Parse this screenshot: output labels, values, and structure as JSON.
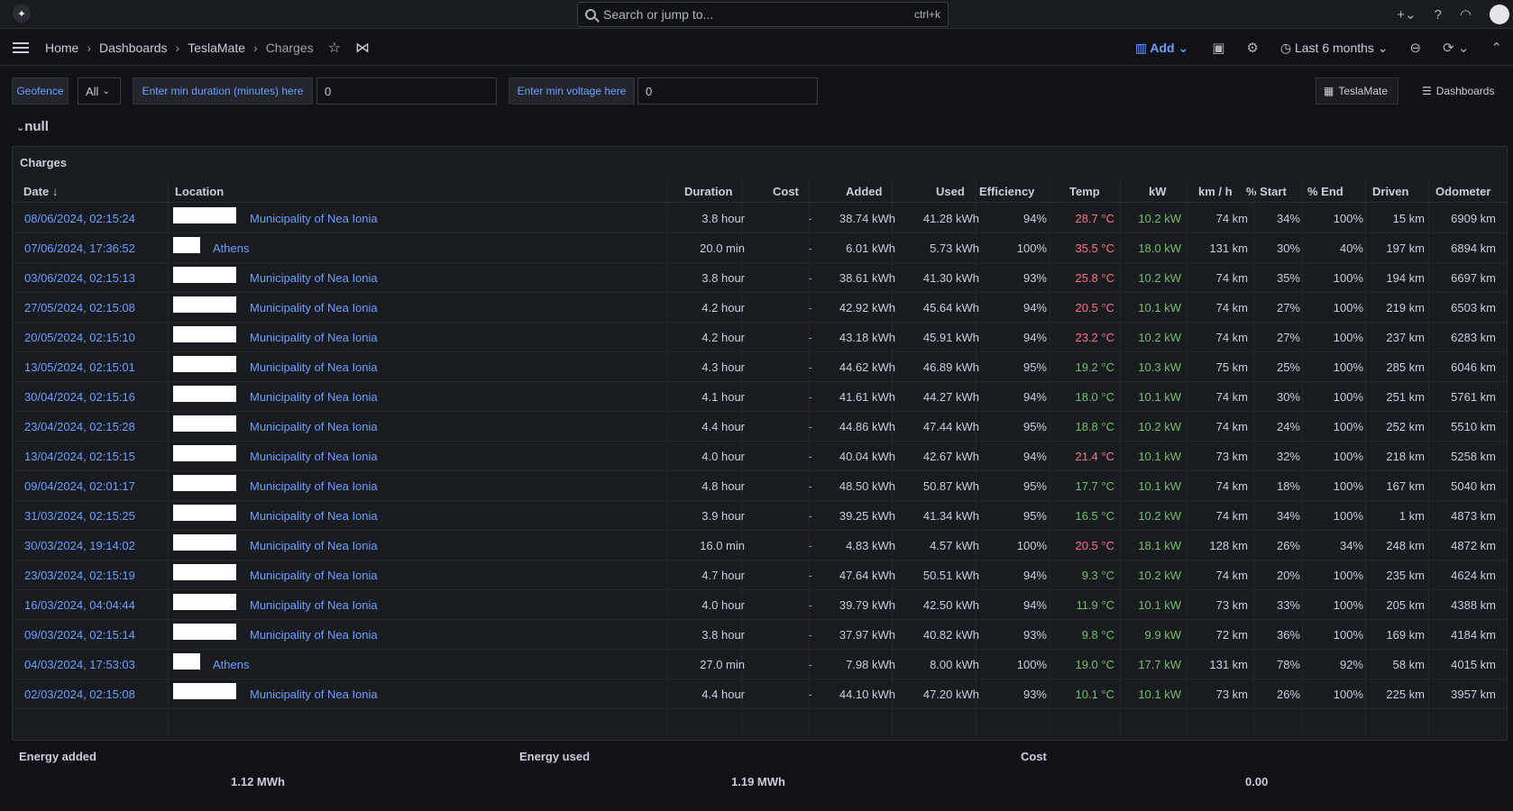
{
  "topbar": {
    "search_placeholder": "Search or jump to...",
    "search_shortcut": "ctrl+k"
  },
  "breadcrumb": [
    "Home",
    "Dashboards",
    "TeslaMate",
    "Charges"
  ],
  "navbar": {
    "add_label": "Add",
    "time_range": "Last 6 months"
  },
  "variables": {
    "geofence_label": "Geofence",
    "geofence_value": "All",
    "min_duration_label": "Enter min duration (minutes) here",
    "min_duration_value": "0",
    "min_voltage_label": "Enter min voltage here",
    "min_voltage_value": "0",
    "link_teslamate": "TeslaMate",
    "link_dashboards": "Dashboards"
  },
  "row_title": "null",
  "panel": {
    "title": "Charges",
    "columns": [
      "Date",
      "Location",
      "Duration",
      "Cost",
      "Added",
      "Used",
      "Efficiency",
      "Temp",
      "kW",
      "km / h",
      "% Start",
      "% End",
      "Driven",
      "Odometer"
    ],
    "rows": [
      {
        "date": "08/06/2024, 02:15:24",
        "location": "Municipality of Nea Ionia",
        "duration": "3.8 hour",
        "cost": "-",
        "added": "38.74 kWh",
        "used": "41.28 kWh",
        "efficiency": "94%",
        "temp": "28.7 °C",
        "temp_color": "#ff7383",
        "kw": "10.2 kW",
        "kmh": "74 km",
        "start": "34%",
        "end": "100%",
        "driven": "15 km",
        "odometer": "6909 km"
      },
      {
        "date": "07/06/2024, 17:36:52",
        "location": "Athens",
        "duration": "20.0 min",
        "cost": "-",
        "added": "6.01 kWh",
        "used": "5.73 kWh",
        "efficiency": "100%",
        "temp": "35.5 °C",
        "temp_color": "#ff7383",
        "kw": "18.0 kW",
        "kmh": "131 km",
        "start": "30%",
        "end": "40%",
        "driven": "197 km",
        "odometer": "6894 km"
      },
      {
        "date": "03/06/2024, 02:15:13",
        "location": "Municipality of Nea Ionia",
        "duration": "3.8 hour",
        "cost": "-",
        "added": "38.61 kWh",
        "used": "41.30 kWh",
        "efficiency": "93%",
        "temp": "25.8 °C",
        "temp_color": "#ff7383",
        "kw": "10.2 kW",
        "kmh": "74 km",
        "start": "35%",
        "end": "100%",
        "driven": "194 km",
        "odometer": "6697 km"
      },
      {
        "date": "27/05/2024, 02:15:08",
        "location": "Municipality of Nea Ionia",
        "duration": "4.2 hour",
        "cost": "-",
        "added": "42.92 kWh",
        "used": "45.64 kWh",
        "efficiency": "94%",
        "temp": "20.5 °C",
        "temp_color": "#ff7383",
        "kw": "10.1 kW",
        "kmh": "74 km",
        "start": "27%",
        "end": "100%",
        "driven": "219 km",
        "odometer": "6503 km"
      },
      {
        "date": "20/05/2024, 02:15:10",
        "location": "Municipality of Nea Ionia",
        "duration": "4.2 hour",
        "cost": "-",
        "added": "43.18 kWh",
        "used": "45.91 kWh",
        "efficiency": "94%",
        "temp": "23.2 °C",
        "temp_color": "#ff7383",
        "kw": "10.2 kW",
        "kmh": "74 km",
        "start": "27%",
        "end": "100%",
        "driven": "237 km",
        "odometer": "6283 km"
      },
      {
        "date": "13/05/2024, 02:15:01",
        "location": "Municipality of Nea Ionia",
        "duration": "4.3 hour",
        "cost": "-",
        "added": "44.62 kWh",
        "used": "46.89 kWh",
        "efficiency": "95%",
        "temp": "19.2 °C",
        "temp_color": "#73bf69",
        "kw": "10.3 kW",
        "kmh": "75 km",
        "start": "25%",
        "end": "100%",
        "driven": "285 km",
        "odometer": "6046 km"
      },
      {
        "date": "30/04/2024, 02:15:16",
        "location": "Municipality of Nea Ionia",
        "duration": "4.1 hour",
        "cost": "-",
        "added": "41.61 kWh",
        "used": "44.27 kWh",
        "efficiency": "94%",
        "temp": "18.0 °C",
        "temp_color": "#73bf69",
        "kw": "10.1 kW",
        "kmh": "74 km",
        "start": "30%",
        "end": "100%",
        "driven": "251 km",
        "odometer": "5761 km"
      },
      {
        "date": "23/04/2024, 02:15:28",
        "location": "Municipality of Nea Ionia",
        "duration": "4.4 hour",
        "cost": "-",
        "added": "44.86 kWh",
        "used": "47.44 kWh",
        "efficiency": "95%",
        "temp": "18.8 °C",
        "temp_color": "#73bf69",
        "kw": "10.2 kW",
        "kmh": "74 km",
        "start": "24%",
        "end": "100%",
        "driven": "252 km",
        "odometer": "5510 km"
      },
      {
        "date": "13/04/2024, 02:15:15",
        "location": "Municipality of Nea Ionia",
        "duration": "4.0 hour",
        "cost": "-",
        "added": "40.04 kWh",
        "used": "42.67 kWh",
        "efficiency": "94%",
        "temp": "21.4 °C",
        "temp_color": "#ff7383",
        "kw": "10.1 kW",
        "kmh": "73 km",
        "start": "32%",
        "end": "100%",
        "driven": "218 km",
        "odometer": "5258 km"
      },
      {
        "date": "09/04/2024, 02:01:17",
        "location": "Municipality of Nea Ionia",
        "duration": "4.8 hour",
        "cost": "-",
        "added": "48.50 kWh",
        "used": "50.87 kWh",
        "efficiency": "95%",
        "temp": "17.7 °C",
        "temp_color": "#73bf69",
        "kw": "10.1 kW",
        "kmh": "74 km",
        "start": "18%",
        "end": "100%",
        "driven": "167 km",
        "odometer": "5040 km"
      },
      {
        "date": "31/03/2024, 02:15:25",
        "location": "Municipality of Nea Ionia",
        "duration": "3.9 hour",
        "cost": "-",
        "added": "39.25 kWh",
        "used": "41.34 kWh",
        "efficiency": "95%",
        "temp": "16.5 °C",
        "temp_color": "#73bf69",
        "kw": "10.2 kW",
        "kmh": "74 km",
        "start": "34%",
        "end": "100%",
        "driven": "1 km",
        "odometer": "4873 km"
      },
      {
        "date": "30/03/2024, 19:14:02",
        "location": "Municipality of Nea Ionia",
        "duration": "16.0 min",
        "cost": "-",
        "added": "4.83 kWh",
        "used": "4.57 kWh",
        "efficiency": "100%",
        "temp": "20.5 °C",
        "temp_color": "#ff7383",
        "kw": "18.1 kW",
        "kmh": "128 km",
        "start": "26%",
        "end": "34%",
        "driven": "248 km",
        "odometer": "4872 km"
      },
      {
        "date": "23/03/2024, 02:15:19",
        "location": "Municipality of Nea Ionia",
        "duration": "4.7 hour",
        "cost": "-",
        "added": "47.64 kWh",
        "used": "50.51 kWh",
        "efficiency": "94%",
        "temp": "9.3 °C",
        "temp_color": "#73bf69",
        "kw": "10.2 kW",
        "kmh": "74 km",
        "start": "20%",
        "end": "100%",
        "driven": "235 km",
        "odometer": "4624 km"
      },
      {
        "date": "16/03/2024, 04:04:44",
        "location": "Municipality of Nea Ionia",
        "duration": "4.0 hour",
        "cost": "-",
        "added": "39.79 kWh",
        "used": "42.50 kWh",
        "efficiency": "94%",
        "temp": "11.9 °C",
        "temp_color": "#73bf69",
        "kw": "10.1 kW",
        "kmh": "73 km",
        "start": "33%",
        "end": "100%",
        "driven": "205 km",
        "odometer": "4388 km"
      },
      {
        "date": "09/03/2024, 02:15:14",
        "location": "Municipality of Nea Ionia",
        "duration": "3.8 hour",
        "cost": "-",
        "added": "37.97 kWh",
        "used": "40.82 kWh",
        "efficiency": "93%",
        "temp": "9.8 °C",
        "temp_color": "#73bf69",
        "kw": "9.9 kW",
        "kmh": "72 km",
        "start": "36%",
        "end": "100%",
        "driven": "169 km",
        "odometer": "4184 km"
      },
      {
        "date": "04/03/2024, 17:53:03",
        "location": "Athens",
        "duration": "27.0 min",
        "cost": "-",
        "added": "7.98 kWh",
        "used": "8.00 kWh",
        "efficiency": "100%",
        "temp": "19.0 °C",
        "temp_color": "#73bf69",
        "kw": "17.7 kW",
        "kmh": "131 km",
        "start": "78%",
        "end": "92%",
        "driven": "58 km",
        "odometer": "4015 km"
      },
      {
        "date": "02/03/2024, 02:15:08",
        "location": "Municipality of Nea Ionia",
        "duration": "4.4 hour",
        "cost": "-",
        "added": "44.10 kWh",
        "used": "47.20 kWh",
        "efficiency": "93%",
        "temp": "10.1 °C",
        "temp_color": "#73bf69",
        "kw": "10.1 kW",
        "kmh": "73 km",
        "start": "26%",
        "end": "100%",
        "driven": "225 km",
        "odometer": "3957 km"
      }
    ]
  },
  "stats": {
    "energy_added_title": "Energy added",
    "energy_added_value": "1.12 MWh",
    "energy_used_title": "Energy used",
    "energy_used_value": "1.19 MWh",
    "cost_title": "Cost",
    "cost_value": "0.00"
  },
  "colors": {
    "link": "#6e9fff",
    "kw_green": "#73bf69",
    "temp_warm": "#ff7383",
    "temp_cool": "#73bf69"
  }
}
